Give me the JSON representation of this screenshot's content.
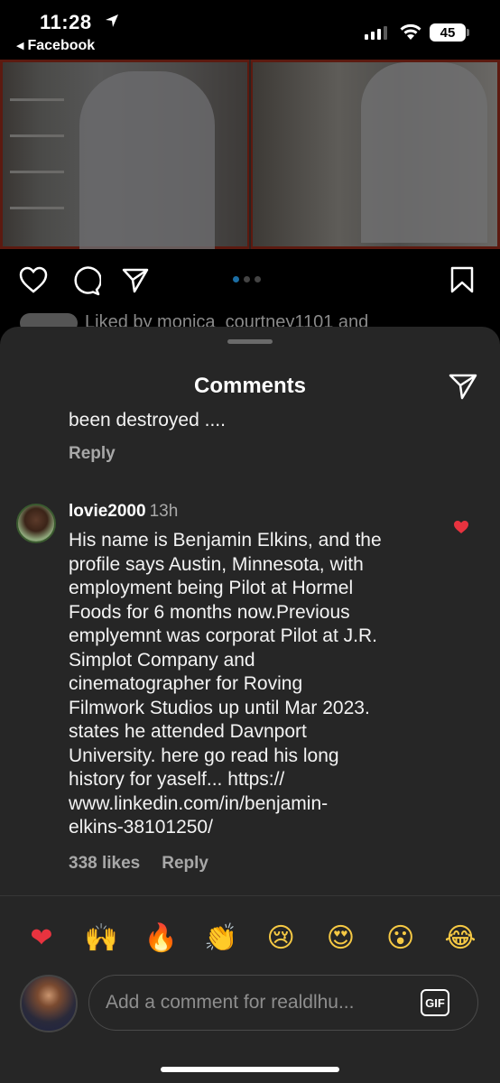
{
  "status_bar": {
    "time": "11:28",
    "back_app": "Facebook",
    "battery": "45"
  },
  "post": {
    "liked_by_text": "Liked by monica_courtney1101 and"
  },
  "sheet": {
    "title": "Comments"
  },
  "previous_comment": {
    "text_tail": "been destroyed ....",
    "reply_label": "Reply"
  },
  "comment": {
    "username": "lovie2000",
    "time": "13h",
    "body": "His name is Benjamin Elkins, and the\nprofile says Austin, Minnesota, with\nemployment being Pilot at Hormel\nFoods for 6 months now.Previous\nemplyemnt was corporat Pilot at J.R.\nSimplot Company and\ncinematographer for Roving\nFilmwork Studios up until Mar 2023.\nstates he attended Davnport\nUniversity. here go read his long\nhistory for yaself... https://\nwww.linkedin.com/in/benjamin-\nelkins-38101250/",
    "likes": "338 likes",
    "reply_label": "Reply",
    "liked": true
  },
  "reactions": [
    {
      "name": "red-heart",
      "glyph": "❤"
    },
    {
      "name": "raising-hands",
      "glyph": "🙌"
    },
    {
      "name": "fire",
      "glyph": "🔥"
    },
    {
      "name": "clapping-hands",
      "glyph": "👏"
    },
    {
      "name": "crying-face",
      "glyph": "😢"
    },
    {
      "name": "heart-eyes",
      "glyph": "😍"
    },
    {
      "name": "surprised-face",
      "glyph": "😮"
    },
    {
      "name": "tears-of-joy",
      "glyph": "😂"
    }
  ],
  "composer": {
    "placeholder": "Add a comment for realdlhu...",
    "gif_label": "GIF"
  },
  "colors": {
    "sheet_bg": "#262626",
    "heart_red": "#e8333f",
    "muted_text": "#a8a8a8",
    "page_indicator_active": "#1c6ea4"
  }
}
